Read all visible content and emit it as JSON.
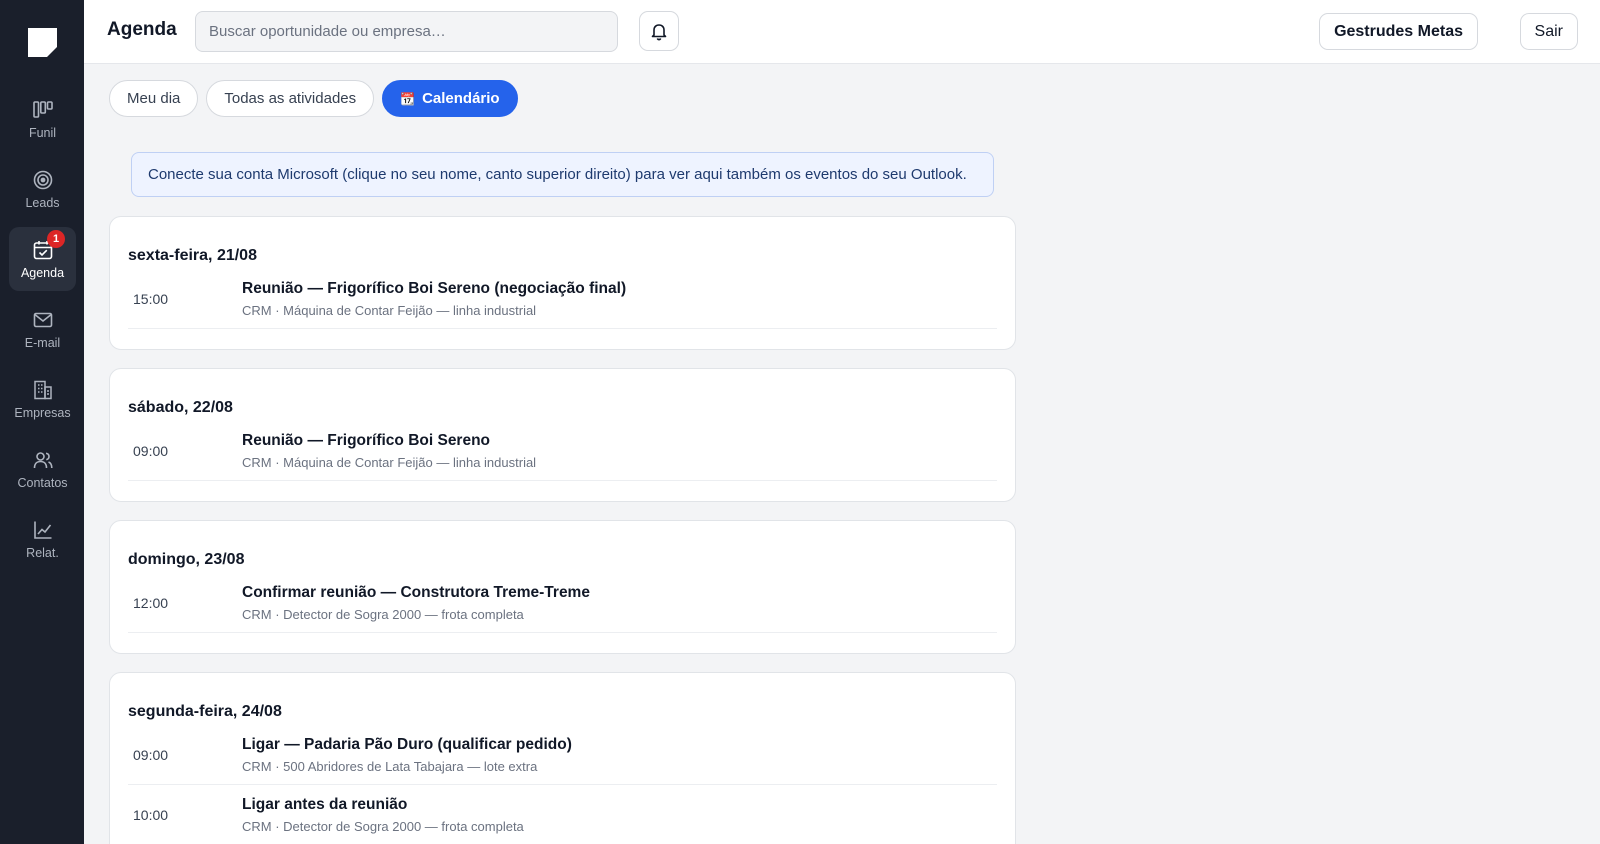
{
  "nav": {
    "items": [
      {
        "label": "Funil",
        "icon": "funnel-columns-icon",
        "active": false,
        "badge": ""
      },
      {
        "label": "Leads",
        "icon": "target-icon",
        "active": false,
        "badge": ""
      },
      {
        "label": "Agenda",
        "icon": "calendar-check-icon",
        "active": true,
        "badge": "1"
      },
      {
        "label": "E-mail",
        "icon": "mail-icon",
        "active": false,
        "badge": ""
      },
      {
        "label": "Empresas",
        "icon": "building-icon",
        "active": false,
        "badge": ""
      },
      {
        "label": "Contatos",
        "icon": "users-icon",
        "active": false,
        "badge": ""
      },
      {
        "label": "Relat.",
        "icon": "chart-line-icon",
        "active": false,
        "badge": ""
      }
    ]
  },
  "header": {
    "title": "Agenda",
    "search_placeholder": "Buscar oportunidade ou empresa…",
    "user_label": "Gestrudes Metas",
    "logout_label": "Sair"
  },
  "tabs": [
    {
      "label": "Meu dia",
      "active": false
    },
    {
      "label": "Todas as atividades",
      "active": false
    },
    {
      "label": "Calendário",
      "active": true,
      "icon": "📆"
    }
  ],
  "notice": "Conecte sua conta Microsoft (clique no seu nome, canto superior direito) para ver aqui também os eventos do seu Outlook.",
  "days": [
    {
      "title": "sexta-feira, 21/08",
      "events": [
        {
          "time": "15:00",
          "title": "Reunião — Frigorífico Boi Sereno (negociação final)",
          "subtitle": "CRM · Máquina de Contar Feijão — linha industrial"
        }
      ]
    },
    {
      "title": "sábado, 22/08",
      "events": [
        {
          "time": "09:00",
          "title": "Reunião — Frigorífico Boi Sereno",
          "subtitle": "CRM · Máquina de Contar Feijão — linha industrial"
        }
      ]
    },
    {
      "title": "domingo, 23/08",
      "events": [
        {
          "time": "12:00",
          "title": "Confirmar reunião — Construtora Treme-Treme",
          "subtitle": "CRM · Detector de Sogra 2000 — frota completa"
        }
      ]
    },
    {
      "title": "segunda-feira, 24/08",
      "events": [
        {
          "time": "09:00",
          "title": "Ligar — Padaria Pão Duro (qualificar pedido)",
          "subtitle": "CRM · 500 Abridores de Lata Tabajara — lote extra"
        },
        {
          "time": "10:00",
          "title": "Ligar antes da reunião",
          "subtitle": "CRM · Detector de Sogra 2000 — frota completa"
        }
      ]
    }
  ],
  "colors": {
    "sidebar_bg": "#1a1f2b",
    "accent": "#2563eb",
    "badge": "#dc2626",
    "notice_bg": "#eef3ff"
  }
}
